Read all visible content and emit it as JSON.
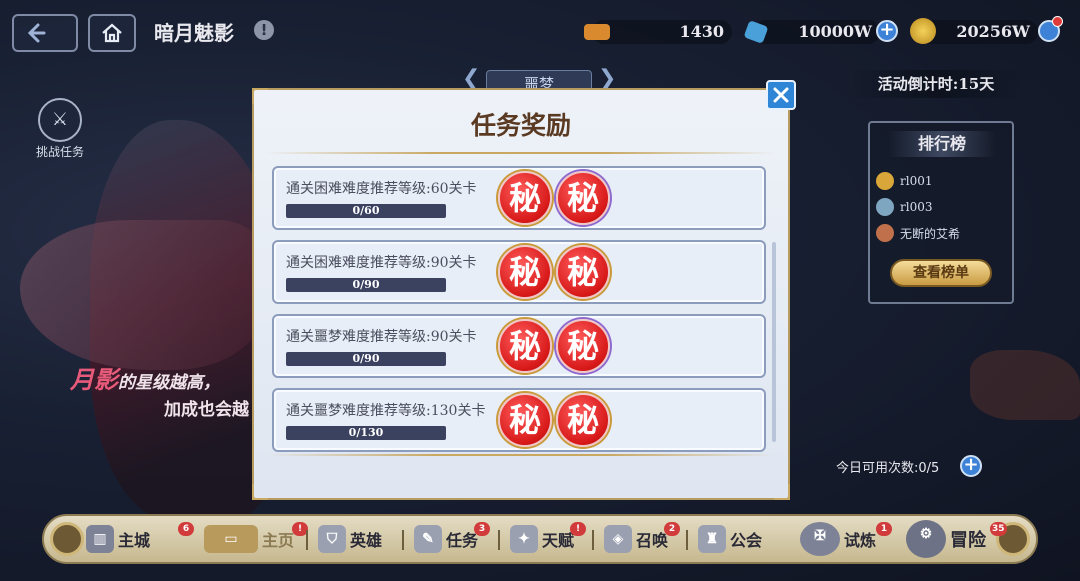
{
  "header": {
    "back_icon": "arrow-left-icon",
    "home_icon": "home-icon",
    "title": "暗月魅影",
    "info_icon": "info-icon"
  },
  "currencies": [
    {
      "name": "ticket",
      "icon": "ticket-icon",
      "value": "1430",
      "color": "#d98a2e"
    },
    {
      "name": "gem",
      "icon": "gem-icon",
      "value": "10000W",
      "color": "#4aa0d8"
    },
    {
      "name": "gold",
      "icon": "coin-icon",
      "value": "20256W",
      "color": "#d9b23a"
    }
  ],
  "event": {
    "mode_tab": "噩梦",
    "countdown": "活动倒计时:15天",
    "challenge_label": "挑战任务",
    "daily_uses": "今日可用次数:0/5"
  },
  "promo": {
    "highlight": "月影",
    "line1_rest": "的星级越高，",
    "line2": "加成也会越"
  },
  "ranking": {
    "title": "排行榜",
    "entries": [
      {
        "name": "rl001",
        "medal_color": "#d9a63a"
      },
      {
        "name": "rl003",
        "medal_color": "#7fa6c0"
      },
      {
        "name": "无断的艾希",
        "medal_color": "#c0704a"
      }
    ],
    "view_button": "查看榜单"
  },
  "modal": {
    "title": "任务奖励",
    "close_icon": "close-icon",
    "tasks": [
      {
        "desc": "通关困难难度推荐等级:60关卡",
        "progress": "0/60",
        "fraction": 0,
        "rewards": [
          "秘",
          "秘"
        ]
      },
      {
        "desc": "通关困难难度推荐等级:90关卡",
        "progress": "0/90",
        "fraction": 0,
        "rewards": [
          "秘",
          "秘"
        ]
      },
      {
        "desc": "通关噩梦难度推荐等级:90关卡",
        "progress": "0/90",
        "fraction": 0,
        "rewards": [
          "秘",
          "秘"
        ]
      },
      {
        "desc": "通关噩梦难度推荐等级:130关卡",
        "progress": "0/130",
        "fraction": 0,
        "rewards": [
          "秘",
          "秘"
        ]
      }
    ]
  },
  "nav": {
    "items": [
      {
        "label": "主城",
        "icon": "castle-icon",
        "badge": "6"
      },
      {
        "label": "主页",
        "icon": "scroll-icon",
        "badge": "!"
      },
      {
        "label": "英雄",
        "icon": "helmet-icon",
        "badge": ""
      },
      {
        "label": "任务",
        "icon": "quest-icon",
        "badge": "3"
      },
      {
        "label": "天赋",
        "icon": "talent-icon",
        "badge": "!"
      },
      {
        "label": "召唤",
        "icon": "summon-icon",
        "badge": "2"
      },
      {
        "label": "公会",
        "icon": "guild-icon",
        "badge": ""
      },
      {
        "label": "试炼",
        "icon": "trial-icon",
        "badge": "1"
      },
      {
        "label": "冒险",
        "icon": "adventure-icon",
        "badge": "35"
      }
    ]
  }
}
